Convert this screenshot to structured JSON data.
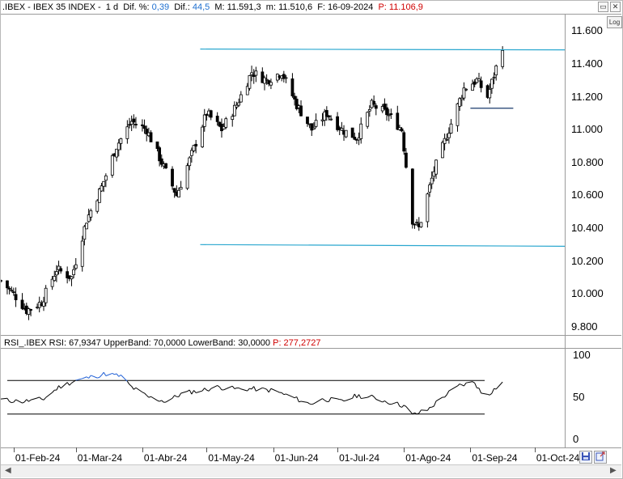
{
  "header": {
    "symbol": ".IBEX - IBEX 35 INDEX -",
    "period": "1 d",
    "dif_pct_label": "Dif. %:",
    "dif_pct_value": "0,39",
    "dif_label": "Dif.:",
    "dif_value": "44,5",
    "max_label": "M: 11.591,3",
    "min_label": "m: 11.510,6",
    "date_label": "F: 16-09-2024",
    "p_label": "P: 11.106,9"
  },
  "window_buttons": {
    "restore": "▭",
    "close": "✕"
  },
  "log_button": "Log",
  "rsi_header": {
    "name": "RSI_.IBEX",
    "rsi": "RSI: 67,9347",
    "upper": "UpperBand: 70,0000",
    "lower": "LowerBand: 30,0000",
    "p": "P: 277,2727"
  },
  "price_axis": [
    "11.600",
    "11.400",
    "11.200",
    "11.000",
    "10.800",
    "10.600",
    "10.400",
    "10.200",
    "10.000",
    "9.800"
  ],
  "rsi_axis": [
    "100",
    "50",
    "0"
  ],
  "date_axis": [
    "01-Feb-24",
    "01-Mar-24",
    "01-Abr-24",
    "01-May-24",
    "01-Jun-24",
    "01-Jul-24",
    "01-Ago-24",
    "01-Sep-24",
    "01-Oct-24"
  ],
  "toolbar": {
    "save_icon": "save-icon",
    "export_icon": "export-icon"
  },
  "colors": {
    "trendline": "#2aa7cf",
    "rsi_over": "#1f5fd6",
    "rsi_under": "#d00000",
    "candle": "#000000"
  },
  "chart_data": [
    {
      "type": "candlestick",
      "title": ".IBEX - IBEX 35 INDEX",
      "ylim": [
        9750,
        11700
      ],
      "x": [
        "2024-01-26",
        "2024-10-15"
      ],
      "approx_close_path": [
        [
          "2024-01-26",
          10080
        ],
        [
          "2024-02-01",
          10000
        ],
        [
          "2024-02-07",
          9900
        ],
        [
          "2024-02-14",
          9950
        ],
        [
          "2024-02-21",
          10150
        ],
        [
          "2024-02-28",
          10100
        ],
        [
          "2024-03-06",
          10450
        ],
        [
          "2024-03-13",
          10650
        ],
        [
          "2024-03-20",
          10900
        ],
        [
          "2024-03-27",
          11050
        ],
        [
          "2024-04-03",
          11000
        ],
        [
          "2024-04-10",
          10800
        ],
        [
          "2024-04-17",
          10600
        ],
        [
          "2024-04-24",
          10850
        ],
        [
          "2024-05-01",
          11100
        ],
        [
          "2024-05-08",
          11000
        ],
        [
          "2024-05-15",
          11150
        ],
        [
          "2024-05-22",
          11350
        ],
        [
          "2024-05-29",
          11300
        ],
        [
          "2024-06-05",
          11350
        ],
        [
          "2024-06-12",
          11150
        ],
        [
          "2024-06-19",
          11000
        ],
        [
          "2024-06-26",
          11100
        ],
        [
          "2024-07-03",
          11000
        ],
        [
          "2024-07-10",
          10950
        ],
        [
          "2024-07-17",
          11150
        ],
        [
          "2024-07-24",
          11100
        ],
        [
          "2024-07-31",
          11000
        ],
        [
          "2024-08-05",
          10450
        ],
        [
          "2024-08-08",
          10400
        ],
        [
          "2024-08-15",
          10750
        ],
        [
          "2024-08-22",
          11000
        ],
        [
          "2024-08-29",
          11250
        ],
        [
          "2024-09-04",
          11300
        ],
        [
          "2024-09-09",
          11200
        ],
        [
          "2024-09-16",
          11510
        ]
      ],
      "trendlines": [
        {
          "from": [
            "2024-04-28",
            11490
          ],
          "to": [
            "2024-10-15",
            11485
          ]
        },
        {
          "from": [
            "2024-04-28",
            10300
          ],
          "to": [
            "2024-10-15",
            10290
          ]
        },
        {
          "from": [
            "2024-09-01",
            11130
          ],
          "to": [
            "2024-09-21",
            11130
          ]
        }
      ]
    },
    {
      "type": "line",
      "title": "RSI_.IBEX",
      "ylim": [
        0,
        100
      ],
      "upper_band": 70,
      "lower_band": 30,
      "approx_path": [
        [
          "2024-01-26",
          47
        ],
        [
          "2024-02-05",
          45
        ],
        [
          "2024-02-15",
          48
        ],
        [
          "2024-02-22",
          62
        ],
        [
          "2024-03-01",
          70
        ],
        [
          "2024-03-08",
          74
        ],
        [
          "2024-03-15",
          78
        ],
        [
          "2024-03-22",
          75
        ],
        [
          "2024-03-27",
          62
        ],
        [
          "2024-04-04",
          50
        ],
        [
          "2024-04-12",
          45
        ],
        [
          "2024-04-20",
          55
        ],
        [
          "2024-04-28",
          58
        ],
        [
          "2024-05-06",
          62
        ],
        [
          "2024-05-15",
          60
        ],
        [
          "2024-05-23",
          60
        ],
        [
          "2024-06-01",
          58
        ],
        [
          "2024-06-10",
          50
        ],
        [
          "2024-06-18",
          42
        ],
        [
          "2024-06-25",
          48
        ],
        [
          "2024-07-03",
          45
        ],
        [
          "2024-07-10",
          52
        ],
        [
          "2024-07-17",
          50
        ],
        [
          "2024-07-24",
          45
        ],
        [
          "2024-08-01",
          40
        ],
        [
          "2024-08-05",
          29
        ],
        [
          "2024-08-12",
          35
        ],
        [
          "2024-08-20",
          52
        ],
        [
          "2024-08-27",
          64
        ],
        [
          "2024-09-03",
          68
        ],
        [
          "2024-09-06",
          55
        ],
        [
          "2024-09-10",
          55
        ],
        [
          "2024-09-16",
          68
        ]
      ]
    }
  ]
}
